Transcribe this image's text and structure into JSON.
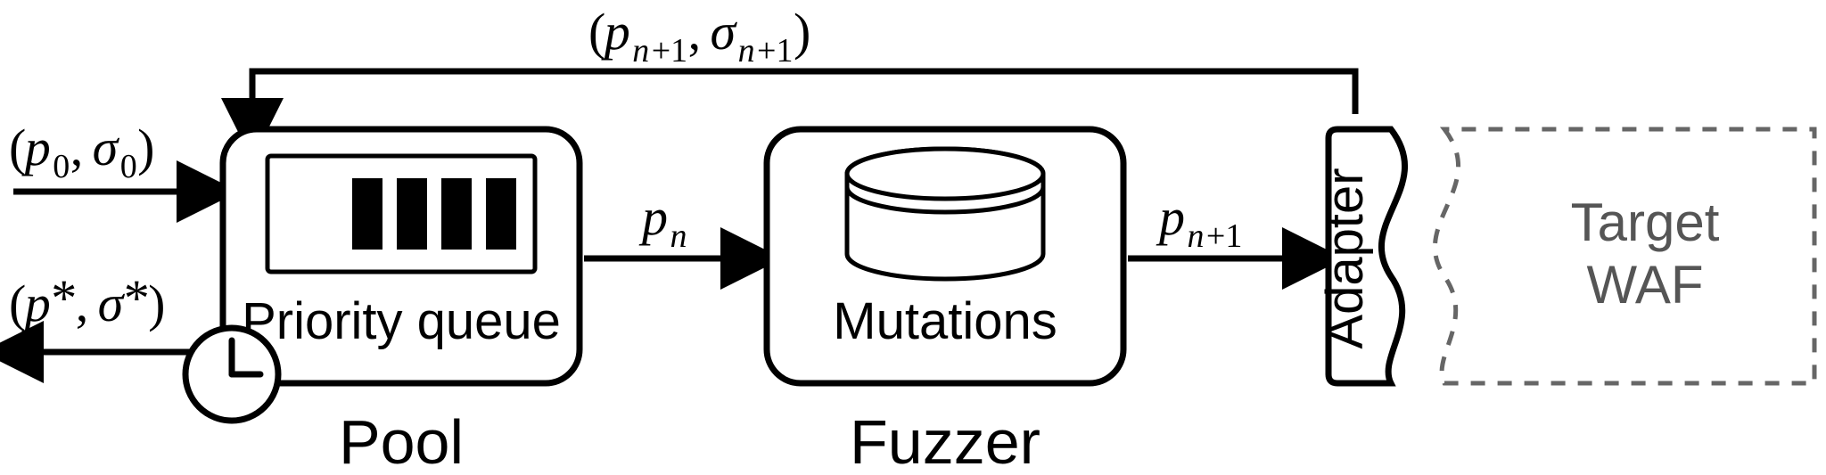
{
  "feedback_label": "(p_{n+1}, σ_{n+1})",
  "input_label": "(p_0, σ_0)",
  "output_label": "(p*, σ*)",
  "edge_pool_to_fuzzer": "p_n",
  "edge_fuzzer_to_adapter": "p_{n+1}",
  "pool": {
    "title": "Pool",
    "inner_label": "Priority queue"
  },
  "fuzzer": {
    "title": "Fuzzer",
    "inner_label": "Mutations"
  },
  "adapter": {
    "title": "Adapter"
  },
  "target": {
    "title_line1": "Target",
    "title_line2": "WAF"
  }
}
